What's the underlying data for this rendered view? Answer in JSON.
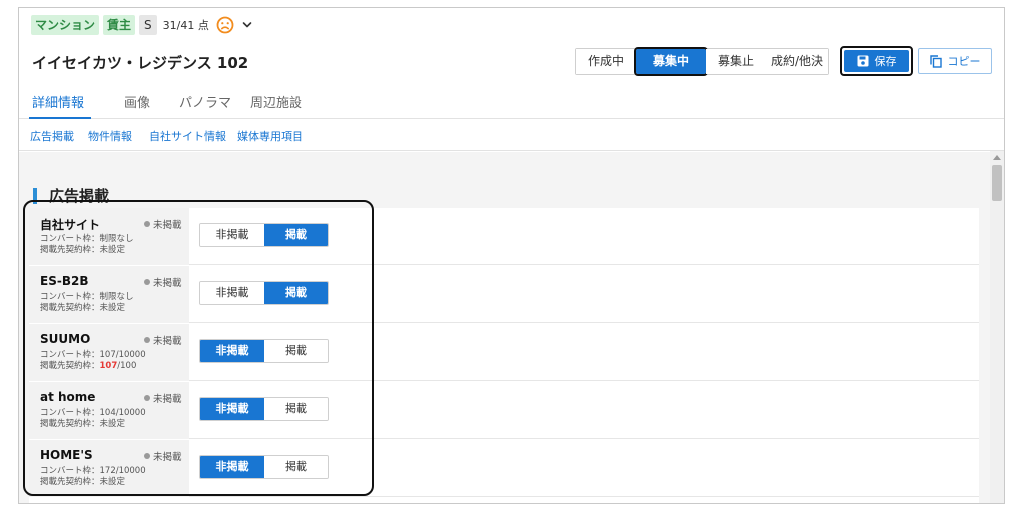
{
  "header": {
    "tags": [
      "マンション",
      "賃主"
    ],
    "grade": "S",
    "score": "31/41 点",
    "title": "イイセイカツ・レジデンス 102"
  },
  "status_buttons": [
    "作成中",
    "募集中",
    "募集止",
    "成約/他決"
  ],
  "active_status": "募集中",
  "actions": {
    "save": "保存",
    "copy": "コピー"
  },
  "main_tabs": [
    "詳細情報",
    "画像",
    "パノラマ",
    "周辺施設"
  ],
  "sub_tabs": [
    "広告掲載",
    "物件情報",
    "自社サイト情報",
    "媒体専用項目"
  ],
  "section_title": "広告掲載",
  "publish_options": {
    "off": "非掲載",
    "on": "掲載"
  },
  "media": [
    {
      "name": "自社サイト",
      "state": "未掲載",
      "convert": "コンバート枠：制限なし",
      "contract_prefix": "掲載先契約枠：",
      "contract": "未設定",
      "contract_used": "",
      "published": true
    },
    {
      "name": "ES-B2B",
      "state": "未掲載",
      "convert": "コンバート枠：制限なし",
      "contract_prefix": "掲載先契約枠：",
      "contract": "未設定",
      "contract_used": "",
      "published": true
    },
    {
      "name": "SUUMO",
      "state": "未掲載",
      "convert": "コンバート枠：107/10000",
      "contract_prefix": "掲載先契約枠：",
      "contract": "/100",
      "contract_used": "107",
      "published": false
    },
    {
      "name": "at home",
      "state": "未掲載",
      "convert": "コンバート枠：104/10000",
      "contract_prefix": "掲載先契約枠：",
      "contract": "未設定",
      "contract_used": "",
      "published": false
    },
    {
      "name": "HOME'S",
      "state": "未掲載",
      "convert": "コンバート枠：172/10000",
      "contract_prefix": "掲載先契約枠：",
      "contract": "未設定",
      "contract_used": "",
      "published": false
    }
  ],
  "colors": {
    "accent": "#1976d2",
    "tag_bg": "#d6f2dc",
    "tag_text": "#2f8b45",
    "warn": "#e53935",
    "face": "#f28c1e"
  },
  "icons": {
    "face": "frown-face-icon",
    "chevron": "chevron-down-icon",
    "save": "floppy-disk-icon",
    "copy": "copy-icon"
  }
}
